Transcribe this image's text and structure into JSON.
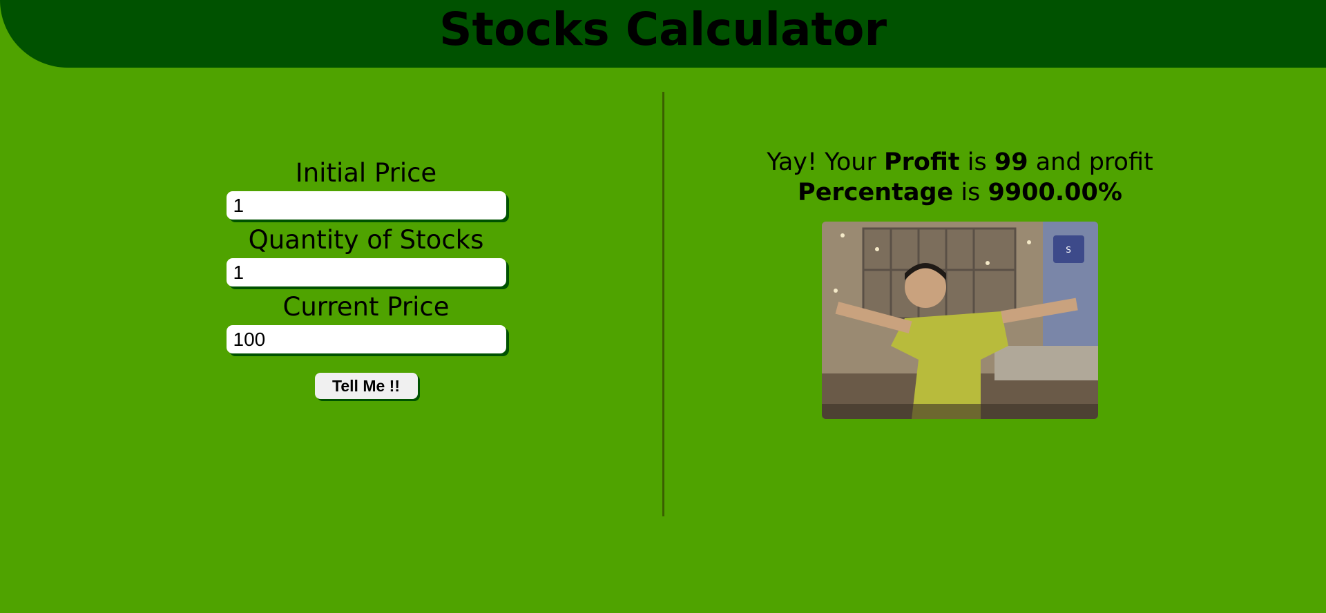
{
  "header": {
    "title": "Stocks Calculator"
  },
  "form": {
    "initial_price": {
      "label": "Initial Price",
      "value": "1"
    },
    "quantity": {
      "label": "Quantity of Stocks",
      "value": "1"
    },
    "current_price": {
      "label": "Current Price",
      "value": "100"
    },
    "submit_label": "Tell Me !!"
  },
  "result": {
    "prefix": "Yay! Your ",
    "profit_word": "Profit",
    "is_1": " is ",
    "profit_value": "99",
    "middle": " and profit",
    "percentage_word": "Percentage",
    "is_2": " is ",
    "percentage_value": "9900.00%"
  },
  "colors": {
    "background": "#4fa300",
    "header": "#005200",
    "input_shadow": "#005200"
  },
  "image": {
    "semantic": "celebration-gif"
  }
}
